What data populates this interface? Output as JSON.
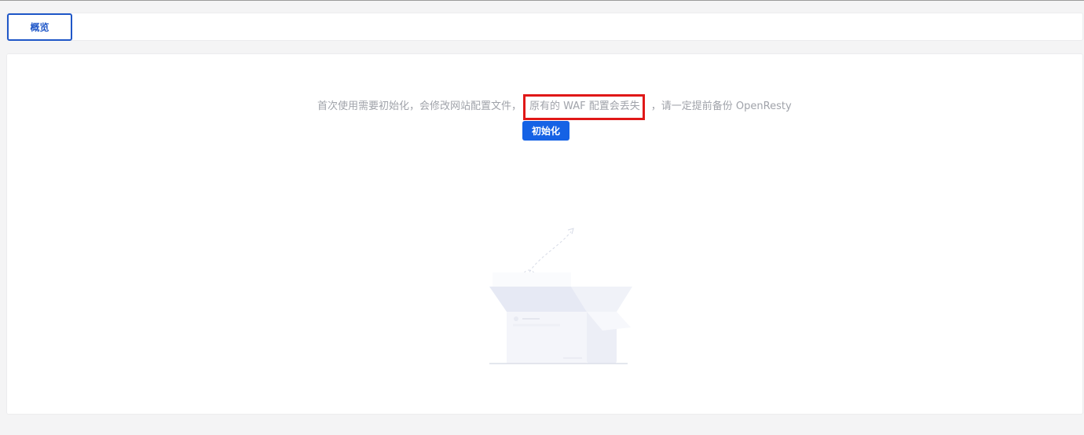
{
  "tabs": [
    {
      "label": "概览",
      "active": true
    }
  ],
  "notice": {
    "before": "首次使用需要初始化，会修改网站配置文件，",
    "highlight": "原有的 WAF 配置会丢失",
    "after": "，请一定提前备份 OpenResty",
    "highlight_color": "#e01818"
  },
  "init_button": {
    "label": "初始化",
    "color": "#1562e5"
  },
  "colors": {
    "tab_active": "#1f57c8",
    "background": "#f4f4f5"
  },
  "illustration": {
    "icon": "empty-box-icon"
  }
}
